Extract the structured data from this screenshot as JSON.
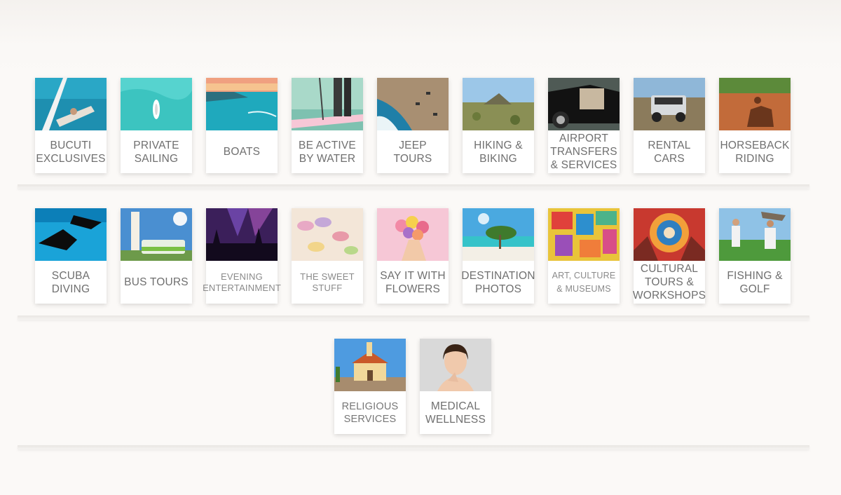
{
  "rows": [
    {
      "items": [
        {
          "label": "BUCUTI EXCLUSIVES",
          "image": "hammock-sea-photo"
        },
        {
          "label": "PRIVATE SAILING",
          "image": "boat-turquoise-photo"
        },
        {
          "label": "BOATS",
          "image": "sunset-coast-photo"
        },
        {
          "label": "BE ACTIVE BY WATER",
          "image": "paddleboard-photo"
        },
        {
          "label": "JEEP TOURS",
          "image": "rocky-coast-photo"
        },
        {
          "label": "HIKING & BIKING",
          "image": "hill-landscape-photo"
        },
        {
          "label": "AIRPORT TRANSFERS & SERVICES",
          "image": "black-car-photo"
        },
        {
          "label": "RENTAL CARS",
          "image": "jeep-photo"
        },
        {
          "label": "HORSEBACK RIDING",
          "image": "horse-shadow-photo"
        }
      ]
    },
    {
      "items": [
        {
          "label": "SCUBA DIVING",
          "image": "divers-photo"
        },
        {
          "label": "BUS TOURS",
          "image": "bus-lighthouse-photo"
        },
        {
          "label": "EVENING ENTERTAINMENT",
          "image": "concert-photo"
        },
        {
          "label": "THE SWEET STUFF",
          "image": "macarons-photo"
        },
        {
          "label": "SAY IT WITH FLOWERS",
          "image": "flowers-photo"
        },
        {
          "label": "DESTINATION PHOTOS",
          "image": "beach-tree-photo"
        },
        {
          "label": "ART, CULTURE & MUSEUMS",
          "image": "art-collage-photo"
        },
        {
          "label": "CULTURAL TOURS & WORKSHOPS",
          "image": "carnival-photo"
        },
        {
          "label": "FISHING & GOLF",
          "image": "golf-fishing-photo"
        }
      ]
    },
    {
      "items": [
        {
          "label": "RELIGIOUS SERVICES",
          "image": "chapel-photo"
        },
        {
          "label": "MEDICAL WELLNESS",
          "image": "woman-portrait-photo"
        }
      ]
    }
  ]
}
